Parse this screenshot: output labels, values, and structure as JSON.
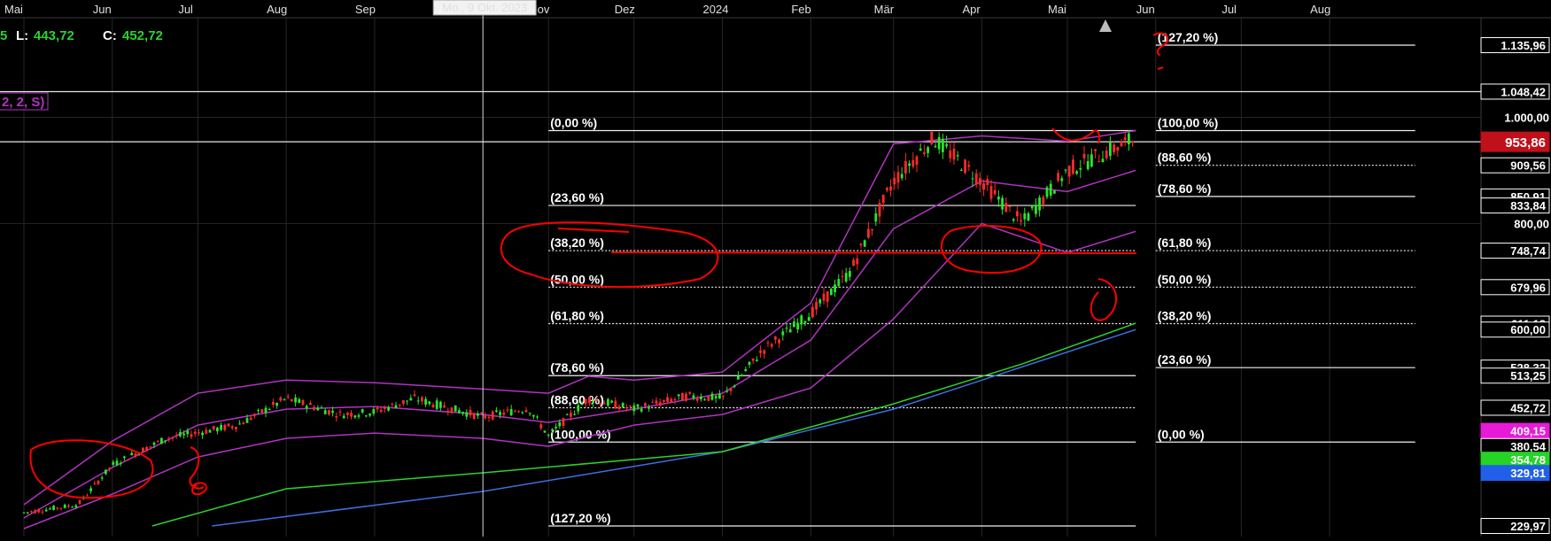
{
  "chart_data": {
    "type": "candlestick",
    "x_axis": {
      "months": [
        {
          "label": "Mai",
          "date": "2023-05-01"
        },
        {
          "label": "Jun",
          "date": "2023-06-01"
        },
        {
          "label": "Jul",
          "date": "2023-07-01"
        },
        {
          "label": "Aug",
          "date": "2023-08-01"
        },
        {
          "label": "Sep",
          "date": "2023-09-01"
        },
        {
          "label": "Nov",
          "date": "2023-11-01"
        },
        {
          "label": "Dez",
          "date": "2023-12-01"
        },
        {
          "label": "2024",
          "date": "2024-01-01"
        },
        {
          "label": "Feb",
          "date": "2024-02-01"
        },
        {
          "label": "Mär",
          "date": "2024-03-01"
        },
        {
          "label": "Apr",
          "date": "2024-04-01"
        },
        {
          "label": "Mai",
          "date": "2024-05-01"
        },
        {
          "label": "Jun",
          "date": "2024-06-01"
        },
        {
          "label": "Jul",
          "date": "2024-07-01"
        },
        {
          "label": "Aug",
          "date": "2024-08-01"
        }
      ],
      "crosshair_label": "Mo., 9 Okt. 2023",
      "crosshair_date": "2023-10-09"
    },
    "y_axis": {
      "range": [
        229.97,
        1135.96
      ],
      "ticks": [
        "1.000,00",
        "800,00"
      ],
      "tick_values": [
        1000,
        800
      ]
    },
    "price_labels": [
      {
        "text": "1.135,96",
        "value": 1135.96,
        "style": "white"
      },
      {
        "text": "1.048,42",
        "value": 1048.42,
        "style": "white"
      },
      {
        "text": "953,86",
        "value": 953.86,
        "style": "red"
      },
      {
        "text": "909,56",
        "value": 909.56,
        "style": "white"
      },
      {
        "text": "850,91",
        "value": 850.91,
        "style": "white"
      },
      {
        "text": "833,84",
        "value": 833.84,
        "style": "white"
      },
      {
        "text": "748,74",
        "value": 748.74,
        "style": "white"
      },
      {
        "text": "679,96",
        "value": 679.96,
        "style": "white"
      },
      {
        "text": "611,18",
        "value": 611.18,
        "style": "white"
      },
      {
        "text": "600,00",
        "value": 600,
        "style": "white"
      },
      {
        "text": "528,32",
        "value": 528.32,
        "style": "white"
      },
      {
        "text": "513,25",
        "value": 513.25,
        "style": "white"
      },
      {
        "text": "452,72",
        "value": 452.72,
        "style": "white"
      },
      {
        "text": "409,15",
        "value": 409.15,
        "style": "magenta"
      },
      {
        "text": "380,54",
        "value": 380.54,
        "style": "white"
      },
      {
        "text": "354,78",
        "value": 354.78,
        "style": "green"
      },
      {
        "text": "329,81",
        "value": 329.81,
        "style": "blue"
      },
      {
        "text": "229,97",
        "value": 229.97,
        "style": "white"
      }
    ],
    "header_info": {
      "low_label": "L:",
      "low_value": "443,72",
      "close_label": "C:",
      "close_value": "452,72",
      "indicator_params": "2, 2, S)"
    },
    "fib_left": {
      "date_from": "2023-11-01",
      "date_to": "2024-05-25",
      "levels": [
        {
          "label": "(0,00 %)",
          "value": 975
        },
        {
          "label": "(23,60 %)",
          "value": 833.84
        },
        {
          "label": "(38,20 %)",
          "value": 748.74
        },
        {
          "label": "(50,00 %)",
          "value": 679.96
        },
        {
          "label": "(61,80 %)",
          "value": 611.18
        },
        {
          "label": "(78,60 %)",
          "value": 513.25
        },
        {
          "label": "(88,60 %)",
          "value": 452.72
        },
        {
          "label": "(100,00 %)",
          "value": 388
        },
        {
          "label": "(127,20 %)",
          "value": 229.97
        }
      ]
    },
    "fib_right": {
      "date_from": "2024-06-01",
      "date_to": "2024-08-31",
      "levels": [
        {
          "label": "(127,20 %)",
          "value": 1135.96
        },
        {
          "label": "(100,00 %)",
          "value": 975
        },
        {
          "label": "(88,60 %)",
          "value": 909.56
        },
        {
          "label": "(78,60 %)",
          "value": 850.91
        },
        {
          "label": "(61,80 %)",
          "value": 748.74
        },
        {
          "label": "(50,00 %)",
          "value": 679.96
        },
        {
          "label": "(38,20 %)",
          "value": 611.18
        },
        {
          "label": "(23,60 %)",
          "value": 528.32
        },
        {
          "label": "(0,00 %)",
          "value": 388
        }
      ]
    },
    "horizontal_lines": [
      {
        "value": 1048.42,
        "date_from": "2023-05-01",
        "date_to": "2024-08-31"
      },
      {
        "value": 953.86,
        "date_from": "2023-05-01",
        "date_to": "2024-08-31"
      }
    ],
    "series": [
      {
        "kind": "ma_long",
        "color": "#3d6fe0",
        "points": [
          [
            "2023-07-06",
            229.97
          ],
          [
            "2023-10-09",
            295
          ],
          [
            "2024-01-01",
            370
          ],
          [
            "2024-03-01",
            450
          ],
          [
            "2024-05-25",
            600
          ]
        ]
      },
      {
        "kind": "ma_mid",
        "color": "#2ed12e",
        "points": [
          [
            "2023-06-15",
            229.97
          ],
          [
            "2023-08-01",
            300
          ],
          [
            "2023-10-09",
            330
          ],
          [
            "2024-01-01",
            370
          ],
          [
            "2024-03-01",
            460
          ],
          [
            "2024-04-15",
            535
          ],
          [
            "2024-05-25",
            612
          ]
        ]
      },
      {
        "kind": "bollinger_upper",
        "color": "#b033c0",
        "points": [
          [
            "2023-05-01",
            270
          ],
          [
            "2023-06-01",
            390
          ],
          [
            "2023-07-01",
            480
          ],
          [
            "2023-08-01",
            505
          ],
          [
            "2023-09-01",
            500
          ],
          [
            "2023-10-09",
            488
          ],
          [
            "2023-11-01",
            480
          ],
          [
            "2023-11-15",
            512
          ],
          [
            "2023-12-01",
            505
          ],
          [
            "2024-01-01",
            520
          ],
          [
            "2024-02-01",
            650
          ],
          [
            "2024-03-01",
            950
          ],
          [
            "2024-04-01",
            965
          ],
          [
            "2024-05-01",
            955
          ],
          [
            "2024-05-25",
            975
          ]
        ]
      },
      {
        "kind": "bollinger_mid",
        "color": "#b033c0",
        "points": [
          [
            "2023-05-01",
            245
          ],
          [
            "2023-06-01",
            340
          ],
          [
            "2023-07-01",
            420
          ],
          [
            "2023-08-01",
            450
          ],
          [
            "2023-09-01",
            455
          ],
          [
            "2023-10-09",
            440
          ],
          [
            "2023-11-01",
            425
          ],
          [
            "2023-12-01",
            450
          ],
          [
            "2024-01-01",
            480
          ],
          [
            "2024-02-01",
            580
          ],
          [
            "2024-03-01",
            790
          ],
          [
            "2024-04-01",
            880
          ],
          [
            "2024-05-01",
            860
          ],
          [
            "2024-05-25",
            900
          ]
        ]
      },
      {
        "kind": "bollinger_lower",
        "color": "#b033c0",
        "points": [
          [
            "2023-05-01",
            225
          ],
          [
            "2023-06-01",
            290
          ],
          [
            "2023-07-01",
            360
          ],
          [
            "2023-08-01",
            395
          ],
          [
            "2023-09-01",
            405
          ],
          [
            "2023-10-09",
            395
          ],
          [
            "2023-11-01",
            380
          ],
          [
            "2023-12-01",
            420
          ],
          [
            "2024-01-01",
            440
          ],
          [
            "2024-02-01",
            490
          ],
          [
            "2024-03-01",
            620
          ],
          [
            "2024-04-01",
            800
          ],
          [
            "2024-05-01",
            745
          ],
          [
            "2024-05-25",
            785
          ]
        ]
      }
    ],
    "price_path": [
      [
        "2023-05-01",
        255
      ],
      [
        "2023-05-20",
        270
      ],
      [
        "2023-06-01",
        345
      ],
      [
        "2023-06-20",
        395
      ],
      [
        "2023-07-15",
        420
      ],
      [
        "2023-08-01",
        470
      ],
      [
        "2023-08-20",
        440
      ],
      [
        "2023-09-01",
        445
      ],
      [
        "2023-09-15",
        470
      ],
      [
        "2023-10-09",
        435
      ],
      [
        "2023-10-25",
        452
      ],
      [
        "2023-11-01",
        400
      ],
      [
        "2023-11-15",
        470
      ],
      [
        "2023-12-01",
        450
      ],
      [
        "2023-12-20",
        475
      ],
      [
        "2024-01-01",
        470
      ],
      [
        "2024-01-15",
        560
      ],
      [
        "2024-02-01",
        630
      ],
      [
        "2024-02-15",
        710
      ],
      [
        "2024-03-01",
        880
      ],
      [
        "2024-03-15",
        960
      ],
      [
        "2024-04-01",
        880
      ],
      [
        "2024-04-15",
        800
      ],
      [
        "2024-05-01",
        900
      ],
      [
        "2024-05-25",
        960
      ]
    ],
    "colors": {
      "background": "#000000",
      "grid": "#262626",
      "text": "#ffffff",
      "bullish_candle": "#29e629",
      "bearish_candle": "#ff2a2a",
      "annotation": "#ff0000",
      "highlight_label": "#c0101a"
    }
  }
}
